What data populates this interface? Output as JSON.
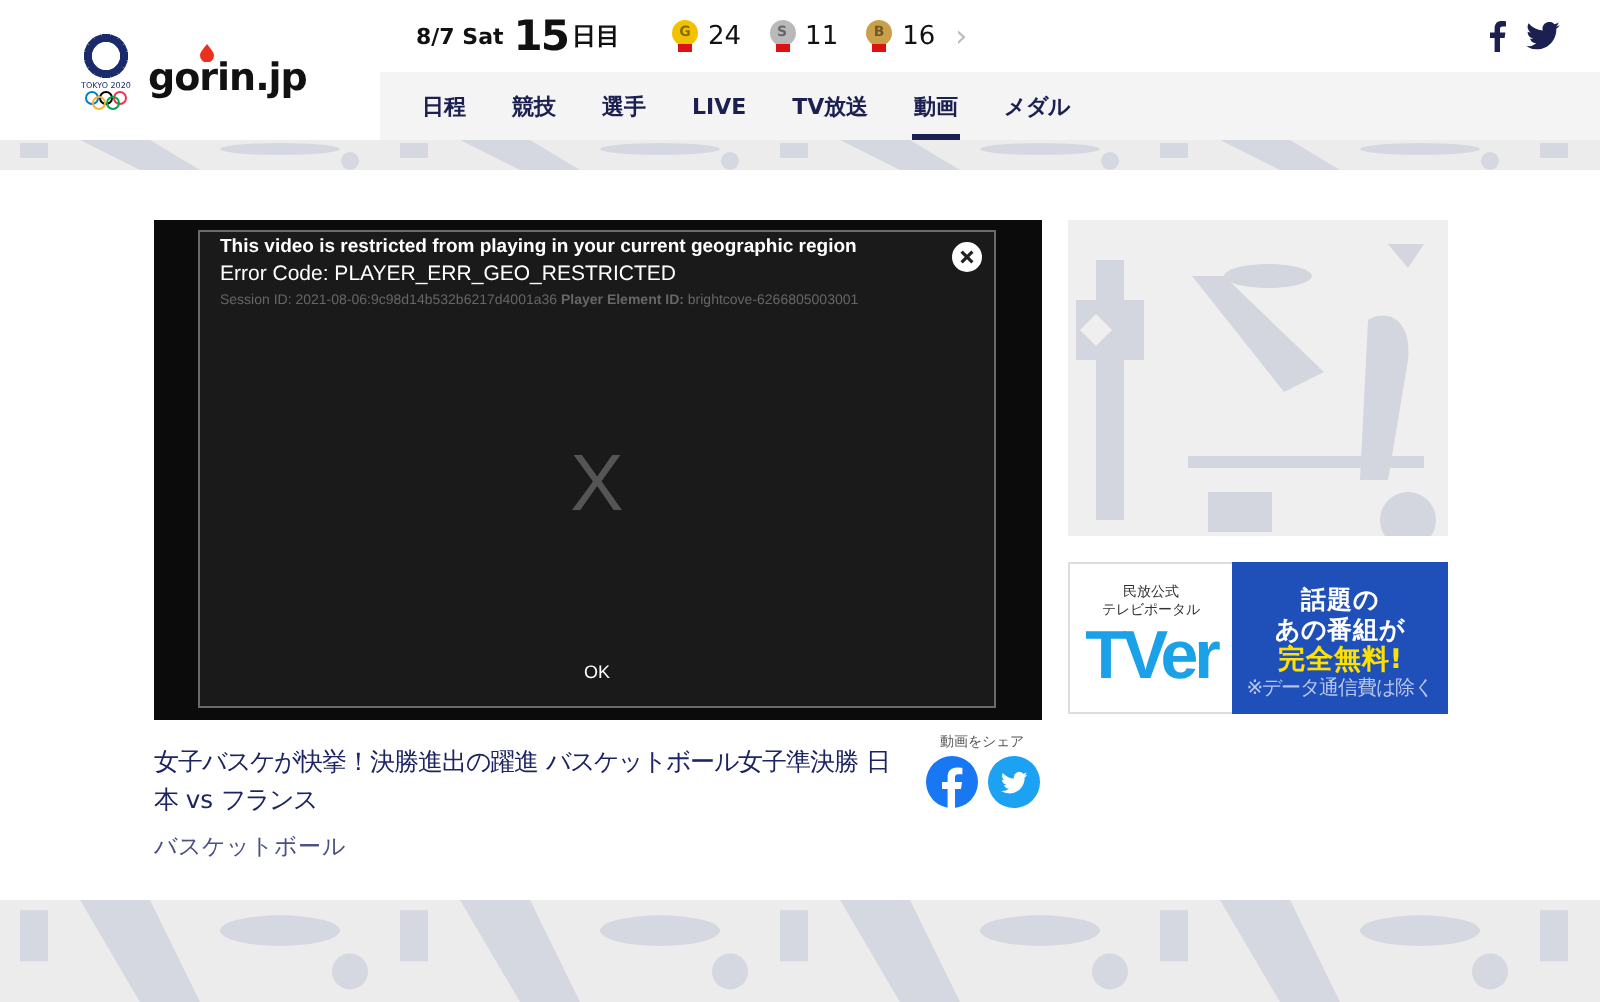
{
  "header": {
    "emblem_caption": "TOKYO 2020",
    "site_name": "gorin.jp",
    "date": "8/7 Sat",
    "day_number": "15",
    "day_suffix": "日目",
    "medals": [
      {
        "kind": "gold",
        "letter": "G",
        "count": "24"
      },
      {
        "kind": "silver",
        "letter": "S",
        "count": "11"
      },
      {
        "kind": "bronze",
        "letter": "B",
        "count": "16"
      }
    ],
    "more": "›"
  },
  "nav": [
    {
      "label": "日程",
      "selected": false
    },
    {
      "label": "競技",
      "selected": false
    },
    {
      "label": "選手",
      "selected": false
    },
    {
      "label": "LIVE",
      "selected": false
    },
    {
      "label": "TV放送",
      "selected": false
    },
    {
      "label": "動画",
      "selected": true
    },
    {
      "label": "メダル",
      "selected": false
    }
  ],
  "player": {
    "error_title": "This video is restricted from playing in your current geographic region",
    "error_code": "Error Code: PLAYER_ERR_GEO_RESTRICTED",
    "session": "Session ID: 2021-08-06:9c98d14b532b6217d4001a36 **Player Element ID:** brightcove-6266805003001",
    "placeholder_mark": "X",
    "ok": "OK"
  },
  "video": {
    "title": "女子バスケが快挙！決勝進出の躍進 バスケットボール女子準決勝 日本 vs フランス",
    "category": "バスケットボール",
    "share_label": "動画をシェア"
  },
  "ad": {
    "tagline": [
      "民放公式",
      "テレビポータル"
    ],
    "brand": "TVer",
    "headline": [
      "話題の",
      "あの番組が"
    ],
    "offer": "完全無料!",
    "note": "※データ通信費は除く"
  }
}
